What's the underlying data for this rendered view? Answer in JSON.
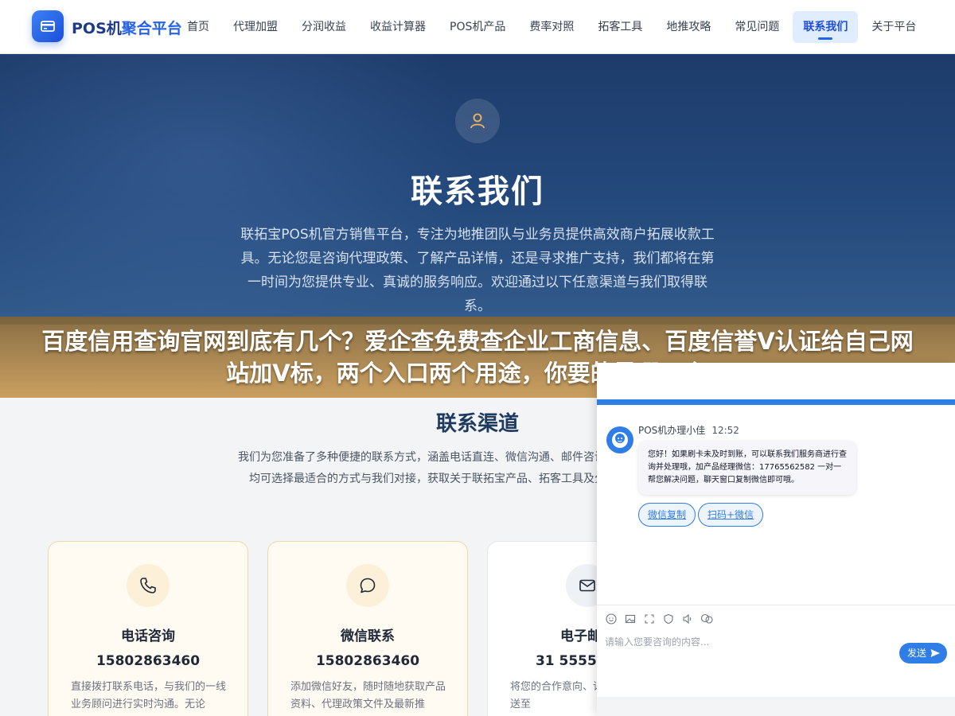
{
  "nav": {
    "brand_prefix": "POS机",
    "brand_accent": "聚合平台",
    "items": [
      {
        "label": "首页"
      },
      {
        "label": "代理加盟"
      },
      {
        "label": "分润收益"
      },
      {
        "label": "收益计算器"
      },
      {
        "label": "POS机产品"
      },
      {
        "label": "费率对照"
      },
      {
        "label": "拓客工具"
      },
      {
        "label": "地推攻略"
      },
      {
        "label": "常见问题"
      },
      {
        "label": "联系我们",
        "active": true
      },
      {
        "label": "关于平台"
      }
    ]
  },
  "hero": {
    "icon": "user-icon",
    "title": "联系我们",
    "description": "联拓宝POS机官方销售平台，专注为地推团队与业务员提供高效商户拓展收款工具。无论您是咨询代理政策、了解产品详情，还是寻求推广支持，我们都将在第一时间为您提供专业、真诚的服务响应。欢迎通过以下任意渠道与我们取得联系。"
  },
  "banner": {
    "text": "百度信用查询官网到底有几个？爱企查免费查企业工商信息、百度信誉V认证给自己网站加V标，两个入口两个用途，你要的是哪一个？"
  },
  "channels": {
    "title": "联系渠道",
    "description": "我们为您准备了多种便捷的联系方式，涵盖电话直连、微信沟通、邮件咨询等，无论您身处何地，均可选择最适合的方式与我们对接，获取关于联拓宝产品、拓客工具及分润政策的详细解答。",
    "cards": [
      {
        "icon": "phone-icon",
        "title": "电话咨询",
        "value": "15802863460",
        "desc": "直接拨打联系电话，与我们的一线业务顾问进行实时沟通。无论"
      },
      {
        "icon": "chat-bubble-icon",
        "title": "微信联系",
        "value": "15802863460",
        "desc": "添加微信好友，随时随地获取产品资料、代理政策文件及最新推"
      },
      {
        "icon": "mail-icon",
        "title": "电子邮件",
        "value": "31 555555 35",
        "desc": "将您的合作意向、详细咨询内容发送至"
      }
    ]
  },
  "chat": {
    "agent_name": "POS机办理小佳",
    "time": "12:52",
    "message": "您好！如果刷卡未及时到账，可以联系我们服务商进行查询并处理哦，加产品经理微信：17765562582 一对一帮您解决问题，聊天窗口复制微信即可哦。",
    "quick_replies": [
      "微信复制",
      "扫码+微信"
    ],
    "input_placeholder": "请输入您要咨询的内容...",
    "send_label": "发送",
    "tools": [
      "emoji-icon",
      "image-icon",
      "screenshot-icon",
      "rate-icon",
      "voice-icon",
      "more-icon"
    ],
    "colors": {
      "accent": "#2f7de6"
    }
  }
}
